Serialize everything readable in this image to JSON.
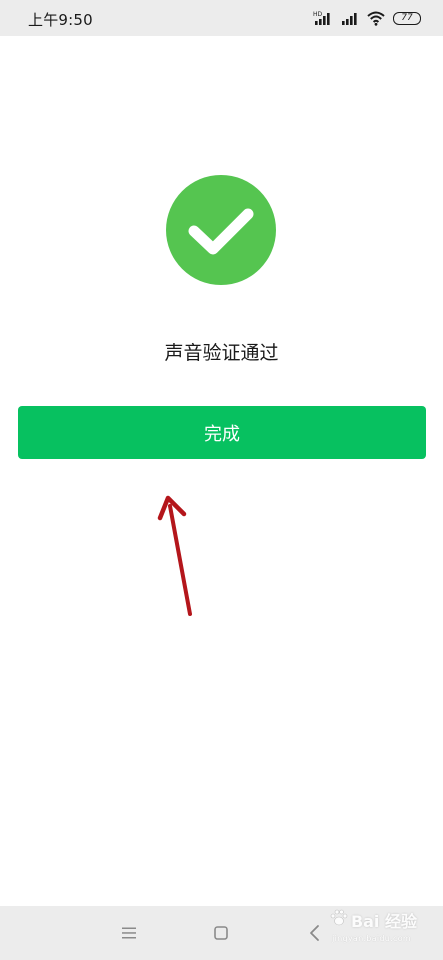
{
  "status_bar": {
    "time": "上午9:50",
    "battery_level": "77",
    "icons": [
      "hd-signal-icon",
      "signal-icon",
      "wifi-icon",
      "battery-icon"
    ]
  },
  "result": {
    "icon": "checkmark-circle-icon",
    "title": "声音验证通过"
  },
  "actions": {
    "done_label": "完成"
  },
  "navigation": {
    "icons": [
      "menu-icon",
      "home-icon",
      "back-icon"
    ]
  },
  "watermark": {
    "text": "Bai 经验",
    "subtext": "jingyan.baidu.com"
  },
  "colors": {
    "success_green": "#55c550",
    "button_green": "#07c160",
    "status_bar_bg": "#ececec",
    "annotation_arrow": "#b4161b"
  }
}
